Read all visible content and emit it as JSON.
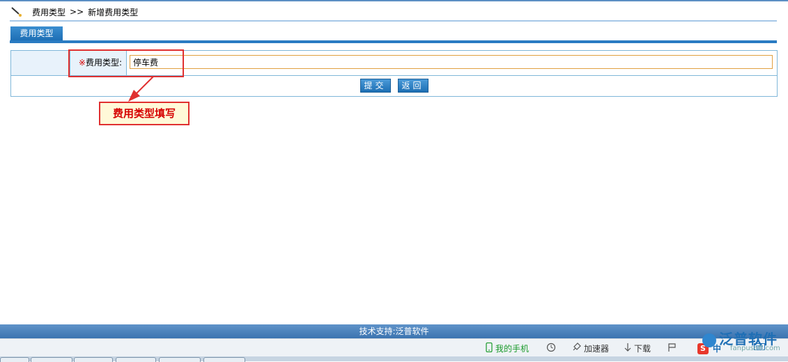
{
  "breadcrumb": {
    "parent": "费用类型",
    "separator": ">>",
    "current": "新增费用类型"
  },
  "tab": {
    "label": "费用类型"
  },
  "form": {
    "required_mark": "※",
    "field_label": "费用类型:",
    "field_value": "停车费",
    "submit_label": "提交",
    "back_label": "返回"
  },
  "annotation": {
    "text": "费用类型填写"
  },
  "footer": {
    "text": "技术支持:泛普软件"
  },
  "statusbar": {
    "my_phone": "我的手机",
    "accelerator": "加速器",
    "download": "下载",
    "ime": "中"
  },
  "brand": {
    "name": "泛普软件",
    "watermark": "fanpusoft.com"
  },
  "colors": {
    "accent": "#2a7bc2",
    "annotation_red": "#e03030"
  }
}
